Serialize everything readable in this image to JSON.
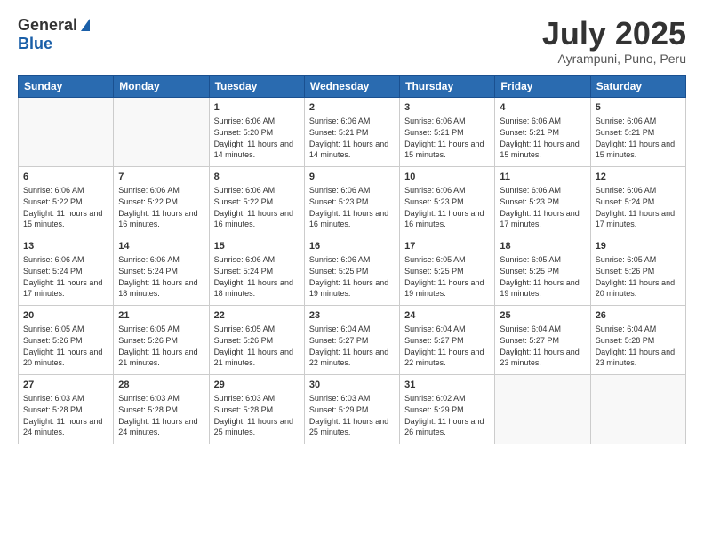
{
  "header": {
    "logo_general": "General",
    "logo_blue": "Blue",
    "month_title": "July 2025",
    "location": "Ayrampuni, Puno, Peru"
  },
  "days_of_week": [
    "Sunday",
    "Monday",
    "Tuesday",
    "Wednesday",
    "Thursday",
    "Friday",
    "Saturday"
  ],
  "weeks": [
    [
      {
        "day": "",
        "info": ""
      },
      {
        "day": "",
        "info": ""
      },
      {
        "day": "1",
        "info": "Sunrise: 6:06 AM\nSunset: 5:20 PM\nDaylight: 11 hours and 14 minutes."
      },
      {
        "day": "2",
        "info": "Sunrise: 6:06 AM\nSunset: 5:21 PM\nDaylight: 11 hours and 14 minutes."
      },
      {
        "day": "3",
        "info": "Sunrise: 6:06 AM\nSunset: 5:21 PM\nDaylight: 11 hours and 15 minutes."
      },
      {
        "day": "4",
        "info": "Sunrise: 6:06 AM\nSunset: 5:21 PM\nDaylight: 11 hours and 15 minutes."
      },
      {
        "day": "5",
        "info": "Sunrise: 6:06 AM\nSunset: 5:21 PM\nDaylight: 11 hours and 15 minutes."
      }
    ],
    [
      {
        "day": "6",
        "info": "Sunrise: 6:06 AM\nSunset: 5:22 PM\nDaylight: 11 hours and 15 minutes."
      },
      {
        "day": "7",
        "info": "Sunrise: 6:06 AM\nSunset: 5:22 PM\nDaylight: 11 hours and 16 minutes."
      },
      {
        "day": "8",
        "info": "Sunrise: 6:06 AM\nSunset: 5:22 PM\nDaylight: 11 hours and 16 minutes."
      },
      {
        "day": "9",
        "info": "Sunrise: 6:06 AM\nSunset: 5:23 PM\nDaylight: 11 hours and 16 minutes."
      },
      {
        "day": "10",
        "info": "Sunrise: 6:06 AM\nSunset: 5:23 PM\nDaylight: 11 hours and 16 minutes."
      },
      {
        "day": "11",
        "info": "Sunrise: 6:06 AM\nSunset: 5:23 PM\nDaylight: 11 hours and 17 minutes."
      },
      {
        "day": "12",
        "info": "Sunrise: 6:06 AM\nSunset: 5:24 PM\nDaylight: 11 hours and 17 minutes."
      }
    ],
    [
      {
        "day": "13",
        "info": "Sunrise: 6:06 AM\nSunset: 5:24 PM\nDaylight: 11 hours and 17 minutes."
      },
      {
        "day": "14",
        "info": "Sunrise: 6:06 AM\nSunset: 5:24 PM\nDaylight: 11 hours and 18 minutes."
      },
      {
        "day": "15",
        "info": "Sunrise: 6:06 AM\nSunset: 5:24 PM\nDaylight: 11 hours and 18 minutes."
      },
      {
        "day": "16",
        "info": "Sunrise: 6:06 AM\nSunset: 5:25 PM\nDaylight: 11 hours and 19 minutes."
      },
      {
        "day": "17",
        "info": "Sunrise: 6:05 AM\nSunset: 5:25 PM\nDaylight: 11 hours and 19 minutes."
      },
      {
        "day": "18",
        "info": "Sunrise: 6:05 AM\nSunset: 5:25 PM\nDaylight: 11 hours and 19 minutes."
      },
      {
        "day": "19",
        "info": "Sunrise: 6:05 AM\nSunset: 5:26 PM\nDaylight: 11 hours and 20 minutes."
      }
    ],
    [
      {
        "day": "20",
        "info": "Sunrise: 6:05 AM\nSunset: 5:26 PM\nDaylight: 11 hours and 20 minutes."
      },
      {
        "day": "21",
        "info": "Sunrise: 6:05 AM\nSunset: 5:26 PM\nDaylight: 11 hours and 21 minutes."
      },
      {
        "day": "22",
        "info": "Sunrise: 6:05 AM\nSunset: 5:26 PM\nDaylight: 11 hours and 21 minutes."
      },
      {
        "day": "23",
        "info": "Sunrise: 6:04 AM\nSunset: 5:27 PM\nDaylight: 11 hours and 22 minutes."
      },
      {
        "day": "24",
        "info": "Sunrise: 6:04 AM\nSunset: 5:27 PM\nDaylight: 11 hours and 22 minutes."
      },
      {
        "day": "25",
        "info": "Sunrise: 6:04 AM\nSunset: 5:27 PM\nDaylight: 11 hours and 23 minutes."
      },
      {
        "day": "26",
        "info": "Sunrise: 6:04 AM\nSunset: 5:28 PM\nDaylight: 11 hours and 23 minutes."
      }
    ],
    [
      {
        "day": "27",
        "info": "Sunrise: 6:03 AM\nSunset: 5:28 PM\nDaylight: 11 hours and 24 minutes."
      },
      {
        "day": "28",
        "info": "Sunrise: 6:03 AM\nSunset: 5:28 PM\nDaylight: 11 hours and 24 minutes."
      },
      {
        "day": "29",
        "info": "Sunrise: 6:03 AM\nSunset: 5:28 PM\nDaylight: 11 hours and 25 minutes."
      },
      {
        "day": "30",
        "info": "Sunrise: 6:03 AM\nSunset: 5:29 PM\nDaylight: 11 hours and 25 minutes."
      },
      {
        "day": "31",
        "info": "Sunrise: 6:02 AM\nSunset: 5:29 PM\nDaylight: 11 hours and 26 minutes."
      },
      {
        "day": "",
        "info": ""
      },
      {
        "day": "",
        "info": ""
      }
    ]
  ]
}
